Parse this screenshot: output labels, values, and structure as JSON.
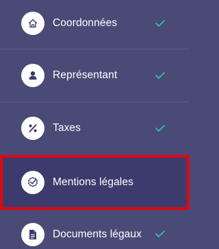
{
  "colors": {
    "background": "#4a4a76",
    "active_background": "#3d3b6d",
    "highlight_border": "#e0070f",
    "check": "#2ecc9a",
    "icon": "#3b3a66"
  },
  "menu": {
    "items": [
      {
        "label": "Coordonnées",
        "icon": "home-icon",
        "completed": true
      },
      {
        "label": "Représentant",
        "icon": "user-icon",
        "completed": true
      },
      {
        "label": "Taxes",
        "icon": "percent-icon",
        "completed": true
      },
      {
        "label": "Mentions légales",
        "icon": "certificate-check-icon",
        "completed": false,
        "active": true
      },
      {
        "label": "Documents légaux",
        "icon": "document-icon",
        "completed": true
      }
    ]
  }
}
